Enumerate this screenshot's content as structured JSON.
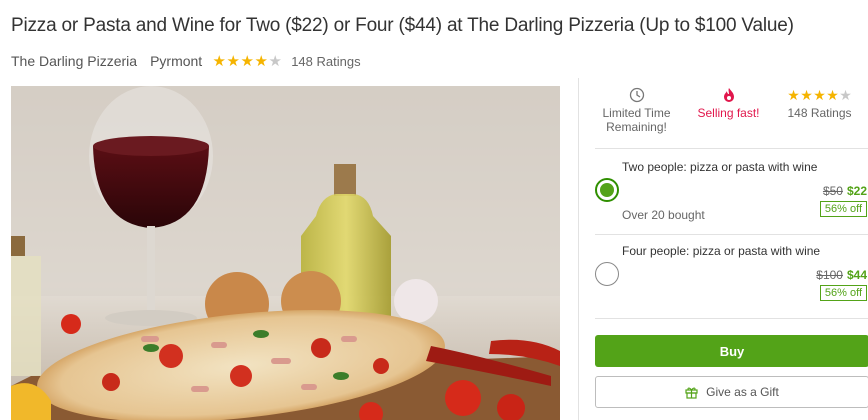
{
  "deal": {
    "title": "Pizza or Pasta and Wine for Two ($22) or Four ($44) at The Darling Pizzeria (Up to $100 Value)",
    "merchant": "The Darling Pizzeria",
    "location": "Pyrmont",
    "rating_stars": 4,
    "ratings_label": "148 Ratings"
  },
  "photo": {
    "alt": "pizza-with-wine"
  },
  "panel": {
    "info": {
      "time_label": "Limited Time Remaining!",
      "selling_label": "Selling fast!",
      "ratings_label": "148 Ratings",
      "rating_stars": 4
    },
    "options": [
      {
        "title": "Two people: pizza or pasta with wine",
        "old_price": "$50",
        "new_price": "$22",
        "discount": "56% off",
        "bought": "Over 20 bought",
        "selected": true
      },
      {
        "title": "Four people: pizza or pasta with wine",
        "old_price": "$100",
        "new_price": "$44",
        "discount": "56% off",
        "bought": "",
        "selected": false
      }
    ],
    "buy_label": "Buy",
    "gift_label": "Give as a Gift"
  },
  "colors": {
    "accent_green": "#53a318",
    "alert_red": "#e1174c",
    "star": "#f5b400"
  },
  "icons": [
    "clock-icon",
    "flame-icon",
    "star-icon",
    "gift-icon"
  ]
}
